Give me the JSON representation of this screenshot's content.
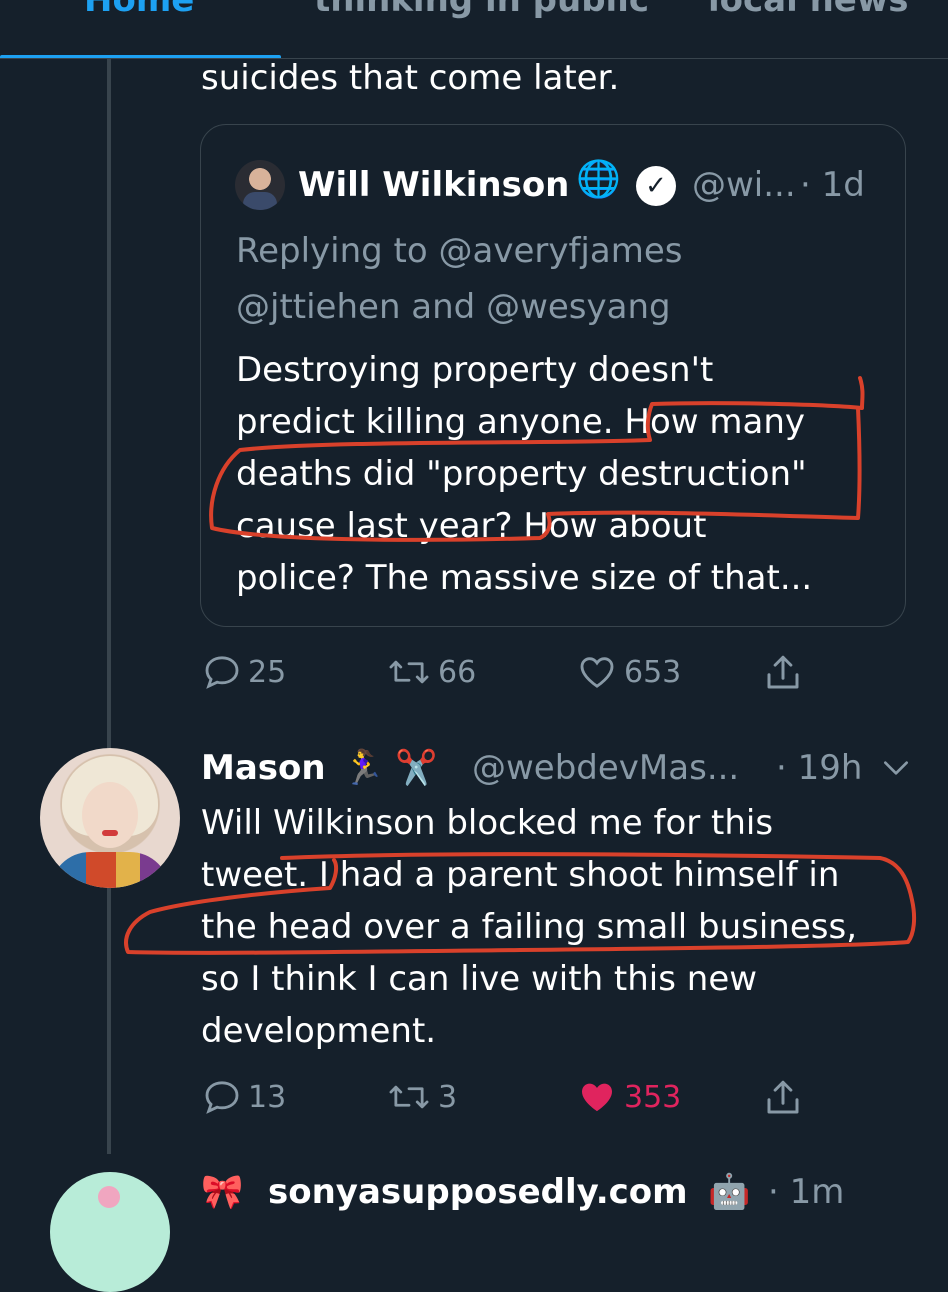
{
  "tabs": [
    {
      "label": "Home",
      "active": true
    },
    {
      "label": "thinking in public",
      "active": false
    },
    {
      "label": "local news",
      "active": false
    }
  ],
  "accent_color": "#1da1f2",
  "like_color": "#e0245e",
  "annotation_color": "#d9412b",
  "parent_tweet": {
    "text_tail": "suicides that come later.",
    "quoted": {
      "author_name": "Will Wilkinson",
      "globe_emoji": "🌐",
      "verified": true,
      "handle": "@wi...",
      "time": "· 1d",
      "replying_line1": "Replying to @averyfjames",
      "replying_line2": "@jttiehen and @wesyang",
      "body_lines": [
        "Destroying property doesn't",
        "predict killing anyone. How many",
        "deaths did \"property destruction\"",
        "cause last year? How about",
        "police? The massive size of that..."
      ]
    },
    "actions": {
      "replies": "25",
      "retweets": "66",
      "likes": "653"
    }
  },
  "reply_tweet": {
    "author_name": "Mason",
    "author_emojis": "🏃‍♀️ ✂️",
    "handle": "@webdevMas...",
    "time": "· 19h",
    "body_lines": [
      "Will Wilkinson blocked me for this",
      "tweet. I had a parent shoot himself in",
      "the head over a failing small business,",
      "so I think I can live with this new",
      "development."
    ],
    "actions": {
      "replies": "13",
      "retweets": "3",
      "likes": "353",
      "liked": true
    }
  },
  "next_tweet": {
    "author_prefix": "🎀",
    "author_name": "sonyasupposedly.com",
    "author_suffix": "🤖",
    "time": "· 1m"
  }
}
